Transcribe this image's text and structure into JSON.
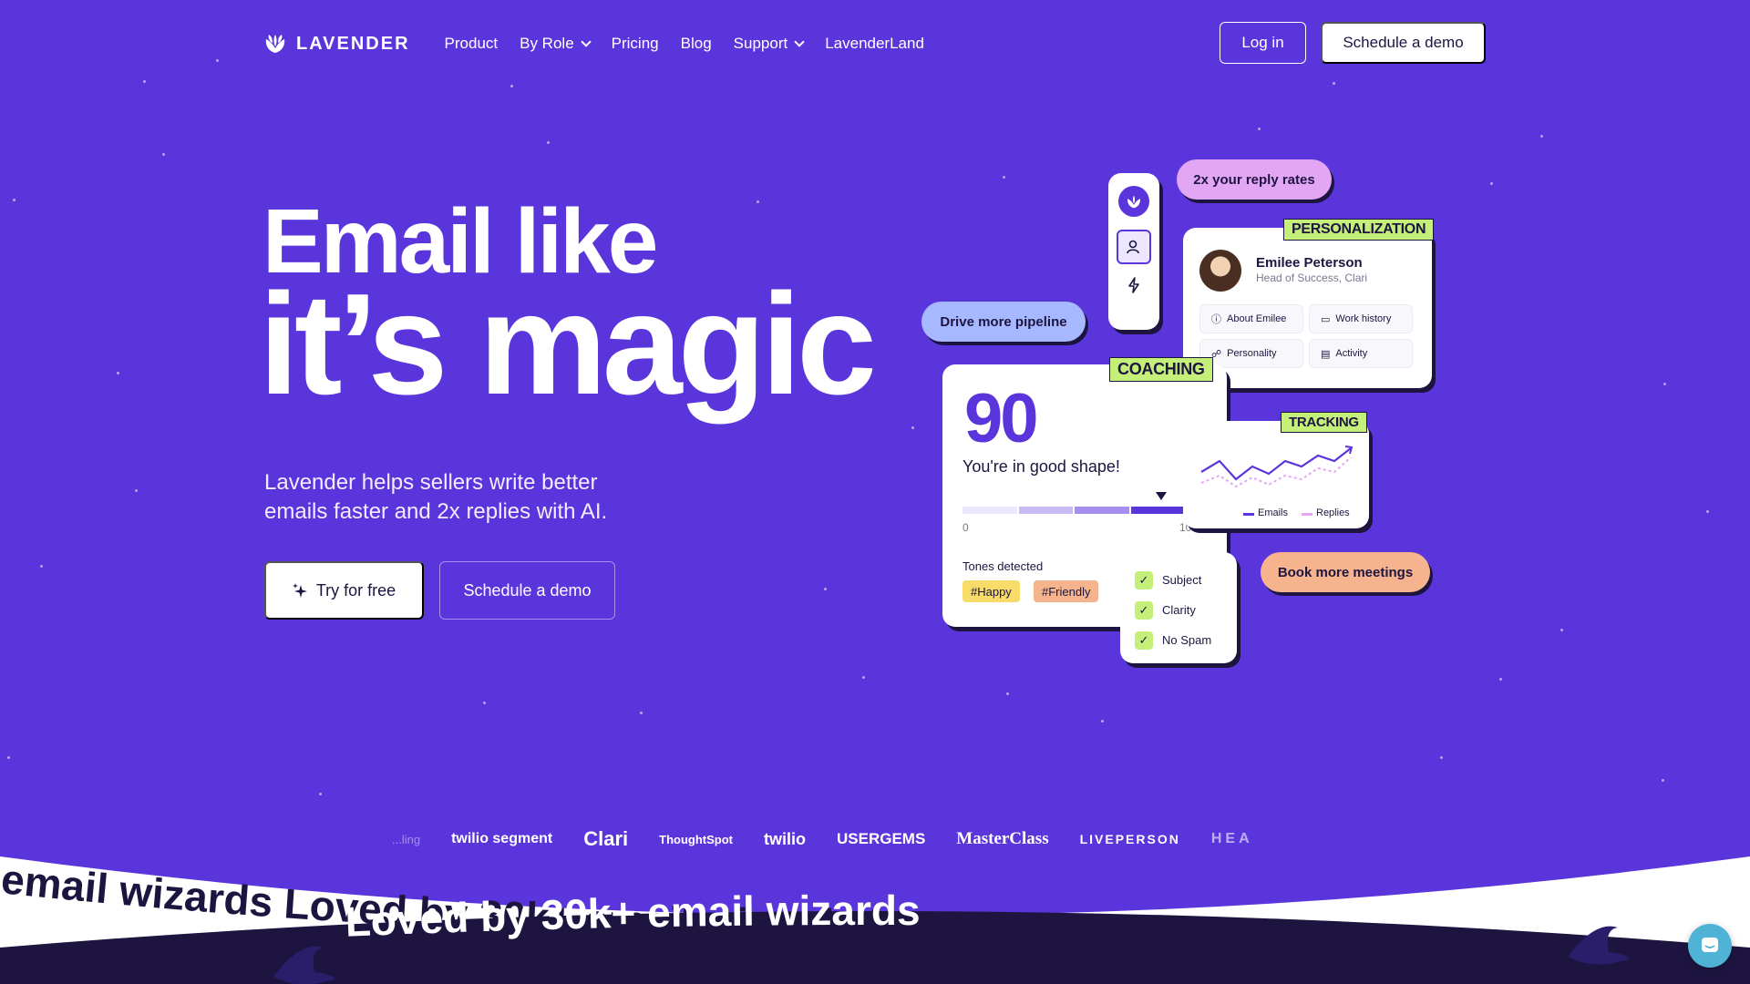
{
  "nav": {
    "logo_text": "LAVENDER",
    "items": [
      "Product",
      "By Role",
      "Pricing",
      "Blog",
      "Support",
      "LavenderLand"
    ],
    "login_label": "Log in",
    "demo_label": "Schedule a demo"
  },
  "hero": {
    "line1": "Email like",
    "line2": "it’s magic",
    "subtitle": "Lavender helps sellers write better emails faster and 2x replies with AI.",
    "try_label": "Try for free",
    "demo_label": "Schedule a demo"
  },
  "cards": {
    "pill_reply": "2x your reply rates",
    "pill_pipeline": "Drive more pipeline",
    "pill_meetings": "Book more meetings",
    "personalization": {
      "tag": "PERSONALIZATION",
      "name": "Emilee Peterson",
      "role": "Head of Success, Clari",
      "chips": [
        "About Emilee",
        "Work history",
        "Personality",
        "Activity"
      ]
    },
    "coaching": {
      "tag": "COACHING",
      "score": "90",
      "status": "You're in good shape!",
      "min": "0",
      "max": "10",
      "tones_label": "Tones detected",
      "tones": [
        "#Happy",
        "#Friendly"
      ]
    },
    "tracking": {
      "tag": "TRACKING",
      "legend": [
        "Emails",
        "Replies"
      ]
    },
    "checks": [
      "Subject",
      "Clarity",
      "No Spam"
    ]
  },
  "logos": [
    "...ling",
    "twilio segment",
    "Clari",
    "ThoughtSpot",
    "twilio",
    "USERGEMS",
    "MasterClass",
    "LIVEPERSON",
    "HEA"
  ],
  "banner": {
    "back_text": "email wizards   Loved by 30k+ email wizards   Love",
    "front_text": "Loved by 30k+ email wizards"
  },
  "colors": {
    "background": "#5b35dc",
    "accent_green": "#c4f07a",
    "pill_pink": "#e3a6f5",
    "pill_blue": "#a6b8ff",
    "pill_peach": "#f5b48d",
    "ink": "#1d1540"
  }
}
